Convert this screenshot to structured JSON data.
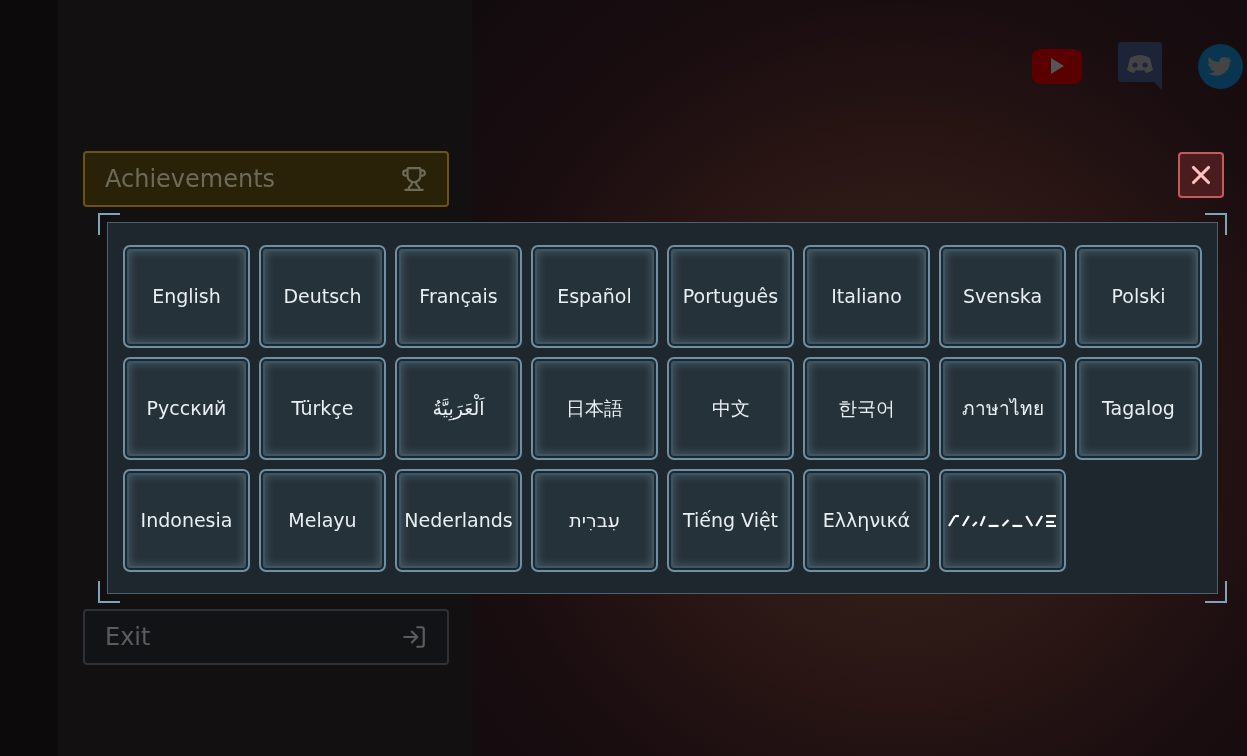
{
  "sidebar": {
    "items": [
      {
        "label": "Achievements",
        "kind": "achievements"
      },
      {
        "label": "Exit",
        "kind": "exit"
      }
    ]
  },
  "language_dialog": {
    "languages": [
      {
        "kind": "text",
        "label": "English"
      },
      {
        "kind": "text",
        "label": "Deutsch"
      },
      {
        "kind": "text",
        "label": "Français"
      },
      {
        "kind": "text",
        "label": "Español"
      },
      {
        "kind": "text",
        "label": "Português"
      },
      {
        "kind": "text",
        "label": "Italiano"
      },
      {
        "kind": "text",
        "label": "Svenska"
      },
      {
        "kind": "text",
        "label": "Polski"
      },
      {
        "kind": "text",
        "label": "Русский"
      },
      {
        "kind": "text",
        "label": "Türkçe"
      },
      {
        "kind": "text",
        "label": "اَلْعَرَبِيَّةُ"
      },
      {
        "kind": "text",
        "label": "日本語"
      },
      {
        "kind": "text",
        "label": "中文"
      },
      {
        "kind": "text",
        "label": "한국어"
      },
      {
        "kind": "text",
        "label": "ภาษาไทย"
      },
      {
        "kind": "text",
        "label": "Tagalog"
      },
      {
        "kind": "text",
        "label": "Indonesia"
      },
      {
        "kind": "text",
        "label": "Melayu"
      },
      {
        "kind": "text",
        "label": "Nederlands"
      },
      {
        "kind": "text",
        "label": "עִברִית"
      },
      {
        "kind": "text",
        "label": "Tiếng Việt"
      },
      {
        "kind": "text",
        "label": "Ελληνικά"
      },
      {
        "kind": "glyphs"
      }
    ]
  }
}
